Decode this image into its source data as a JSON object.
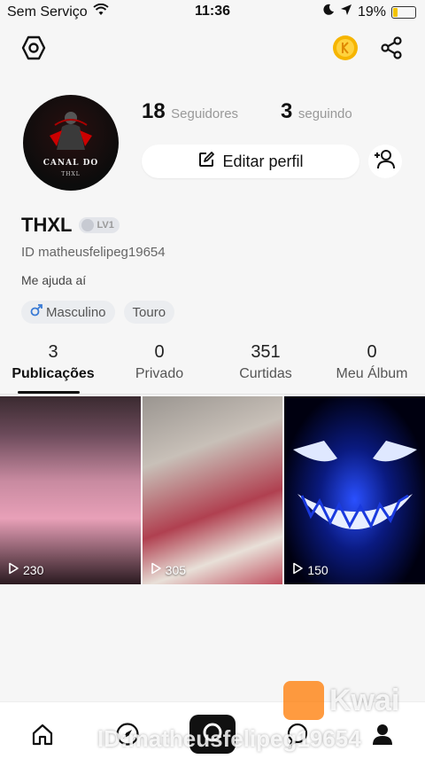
{
  "status_bar": {
    "carrier": "Sem Serviço",
    "time": "11:36",
    "battery": "19%"
  },
  "avatar": {
    "line1": "CANAL DO",
    "line2": "THXL"
  },
  "stats": {
    "followers_count": "18",
    "followers_label": "Seguidores",
    "following_count": "3",
    "following_label": "seguindo"
  },
  "edit_profile_label": "Editar perfil",
  "profile": {
    "name": "THXL",
    "level": "LV1",
    "id_text": "ID matheusfelipeg19654",
    "bio": "Me ajuda aí",
    "tags": [
      "Masculino",
      "Touro"
    ]
  },
  "tabs": [
    {
      "count": "3",
      "label": "Publicações"
    },
    {
      "count": "0",
      "label": "Privado"
    },
    {
      "count": "351",
      "label": "Curtidas"
    },
    {
      "count": "0",
      "label": "Meu Álbum"
    }
  ],
  "posts": [
    {
      "views": "230"
    },
    {
      "views": "305"
    },
    {
      "views": "150"
    }
  ],
  "watermark": {
    "brand": "Kwai",
    "id": "ID:matheusfelipeg19654"
  }
}
